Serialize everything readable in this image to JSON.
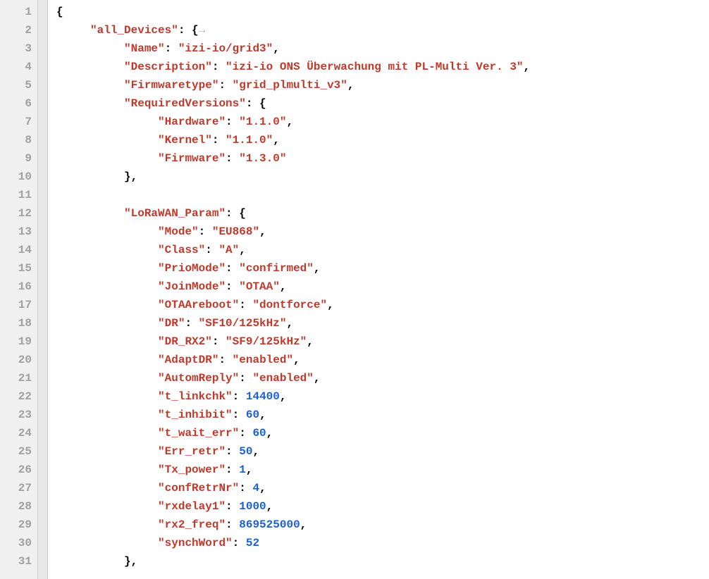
{
  "file": {
    "lines": [
      {
        "num": 1,
        "indent": 0,
        "tokens": [
          {
            "t": "p",
            "v": "{"
          }
        ]
      },
      {
        "num": 2,
        "indent": 1,
        "tokens": [
          {
            "t": "k",
            "v": "\"all_Devices\""
          },
          {
            "t": "p",
            "v": ": {"
          },
          {
            "t": "ws",
            "v": "→"
          }
        ]
      },
      {
        "num": 3,
        "indent": 2,
        "tokens": [
          {
            "t": "k",
            "v": "\"Name\""
          },
          {
            "t": "p",
            "v": ": "
          },
          {
            "t": "s",
            "v": "\"izi-io/grid3\""
          },
          {
            "t": "p",
            "v": ","
          }
        ]
      },
      {
        "num": 4,
        "indent": 2,
        "tokens": [
          {
            "t": "k",
            "v": "\"Description\""
          },
          {
            "t": "p",
            "v": ": "
          },
          {
            "t": "s",
            "v": "\"izi-io ONS Überwachung mit PL-Multi Ver. 3\""
          },
          {
            "t": "p",
            "v": ","
          }
        ]
      },
      {
        "num": 5,
        "indent": 2,
        "tokens": [
          {
            "t": "k",
            "v": "\"Firmwaretype\""
          },
          {
            "t": "p",
            "v": ": "
          },
          {
            "t": "s",
            "v": "\"grid_plmulti_v3\""
          },
          {
            "t": "p",
            "v": ","
          }
        ]
      },
      {
        "num": 6,
        "indent": 2,
        "tokens": [
          {
            "t": "k",
            "v": "\"RequiredVersions\""
          },
          {
            "t": "p",
            "v": ": {"
          }
        ]
      },
      {
        "num": 7,
        "indent": 3,
        "tokens": [
          {
            "t": "k",
            "v": "\"Hardware\""
          },
          {
            "t": "p",
            "v": ": "
          },
          {
            "t": "s",
            "v": "\"1.1.0\""
          },
          {
            "t": "p",
            "v": ","
          }
        ]
      },
      {
        "num": 8,
        "indent": 3,
        "tokens": [
          {
            "t": "k",
            "v": "\"Kernel\""
          },
          {
            "t": "p",
            "v": ": "
          },
          {
            "t": "s",
            "v": "\"1.1.0\""
          },
          {
            "t": "p",
            "v": ","
          }
        ]
      },
      {
        "num": 9,
        "indent": 3,
        "tokens": [
          {
            "t": "k",
            "v": "\"Firmware\""
          },
          {
            "t": "p",
            "v": ": "
          },
          {
            "t": "s",
            "v": "\"1.3.0\""
          }
        ]
      },
      {
        "num": 10,
        "indent": 2,
        "tokens": [
          {
            "t": "p",
            "v": "},"
          }
        ]
      },
      {
        "num": 11,
        "indent": 0,
        "tokens": []
      },
      {
        "num": 12,
        "indent": 2,
        "tokens": [
          {
            "t": "k",
            "v": "\"LoRaWAN_Param\""
          },
          {
            "t": "p",
            "v": ": {"
          }
        ]
      },
      {
        "num": 13,
        "indent": 3,
        "tokens": [
          {
            "t": "k",
            "v": "\"Mode\""
          },
          {
            "t": "p",
            "v": ": "
          },
          {
            "t": "s",
            "v": "\"EU868\""
          },
          {
            "t": "p",
            "v": ","
          }
        ]
      },
      {
        "num": 14,
        "indent": 3,
        "tokens": [
          {
            "t": "k",
            "v": "\"Class\""
          },
          {
            "t": "p",
            "v": ": "
          },
          {
            "t": "s",
            "v": "\"A\""
          },
          {
            "t": "p",
            "v": ","
          }
        ]
      },
      {
        "num": 15,
        "indent": 3,
        "tokens": [
          {
            "t": "k",
            "v": "\"PrioMode\""
          },
          {
            "t": "p",
            "v": ": "
          },
          {
            "t": "s",
            "v": "\"confirmed\""
          },
          {
            "t": "p",
            "v": ","
          }
        ]
      },
      {
        "num": 16,
        "indent": 3,
        "tokens": [
          {
            "t": "k",
            "v": "\"JoinMode\""
          },
          {
            "t": "p",
            "v": ": "
          },
          {
            "t": "s",
            "v": "\"OTAA\""
          },
          {
            "t": "p",
            "v": ","
          }
        ]
      },
      {
        "num": 17,
        "indent": 3,
        "tokens": [
          {
            "t": "k",
            "v": "\"OTAAreboot\""
          },
          {
            "t": "p",
            "v": ": "
          },
          {
            "t": "s",
            "v": "\"dontforce\""
          },
          {
            "t": "p",
            "v": ","
          }
        ]
      },
      {
        "num": 18,
        "indent": 3,
        "tokens": [
          {
            "t": "k",
            "v": "\"DR\""
          },
          {
            "t": "p",
            "v": ": "
          },
          {
            "t": "s",
            "v": "\"SF10/125kHz\""
          },
          {
            "t": "p",
            "v": ","
          }
        ]
      },
      {
        "num": 19,
        "indent": 3,
        "tokens": [
          {
            "t": "k",
            "v": "\"DR_RX2\""
          },
          {
            "t": "p",
            "v": ": "
          },
          {
            "t": "s",
            "v": "\"SF9/125kHz\""
          },
          {
            "t": "p",
            "v": ","
          }
        ]
      },
      {
        "num": 20,
        "indent": 3,
        "tokens": [
          {
            "t": "k",
            "v": "\"AdaptDR\""
          },
          {
            "t": "p",
            "v": ": "
          },
          {
            "t": "s",
            "v": "\"enabled\""
          },
          {
            "t": "p",
            "v": ","
          }
        ]
      },
      {
        "num": 21,
        "indent": 3,
        "tokens": [
          {
            "t": "k",
            "v": "\"AutomReply\""
          },
          {
            "t": "p",
            "v": ": "
          },
          {
            "t": "s",
            "v": "\"enabled\""
          },
          {
            "t": "p",
            "v": ","
          }
        ]
      },
      {
        "num": 22,
        "indent": 3,
        "tokens": [
          {
            "t": "k",
            "v": "\"t_linkchk\""
          },
          {
            "t": "p",
            "v": ": "
          },
          {
            "t": "n",
            "v": "14400"
          },
          {
            "t": "p",
            "v": ","
          }
        ]
      },
      {
        "num": 23,
        "indent": 3,
        "tokens": [
          {
            "t": "k",
            "v": "\"t_inhibit\""
          },
          {
            "t": "p",
            "v": ": "
          },
          {
            "t": "n",
            "v": "60"
          },
          {
            "t": "p",
            "v": ","
          }
        ]
      },
      {
        "num": 24,
        "indent": 3,
        "tokens": [
          {
            "t": "k",
            "v": "\"t_wait_err\""
          },
          {
            "t": "p",
            "v": ": "
          },
          {
            "t": "n",
            "v": "60"
          },
          {
            "t": "p",
            "v": ","
          }
        ]
      },
      {
        "num": 25,
        "indent": 3,
        "tokens": [
          {
            "t": "k",
            "v": "\"Err_retr\""
          },
          {
            "t": "p",
            "v": ": "
          },
          {
            "t": "n",
            "v": "50"
          },
          {
            "t": "p",
            "v": ","
          }
        ]
      },
      {
        "num": 26,
        "indent": 3,
        "tokens": [
          {
            "t": "k",
            "v": "\"Tx_power\""
          },
          {
            "t": "p",
            "v": ": "
          },
          {
            "t": "n",
            "v": "1"
          },
          {
            "t": "p",
            "v": ","
          }
        ]
      },
      {
        "num": 27,
        "indent": 3,
        "tokens": [
          {
            "t": "k",
            "v": "\"confRetrNr\""
          },
          {
            "t": "p",
            "v": ": "
          },
          {
            "t": "n",
            "v": "4"
          },
          {
            "t": "p",
            "v": ","
          }
        ]
      },
      {
        "num": 28,
        "indent": 3,
        "tokens": [
          {
            "t": "k",
            "v": "\"rxdelay1\""
          },
          {
            "t": "p",
            "v": ": "
          },
          {
            "t": "n",
            "v": "1000"
          },
          {
            "t": "p",
            "v": ","
          }
        ]
      },
      {
        "num": 29,
        "indent": 3,
        "tokens": [
          {
            "t": "k",
            "v": "\"rx2_freq\""
          },
          {
            "t": "p",
            "v": ": "
          },
          {
            "t": "n",
            "v": "869525000"
          },
          {
            "t": "p",
            "v": ","
          }
        ]
      },
      {
        "num": 30,
        "indent": 3,
        "tokens": [
          {
            "t": "k",
            "v": "\"synchWord\""
          },
          {
            "t": "p",
            "v": ": "
          },
          {
            "t": "n",
            "v": "52"
          }
        ]
      },
      {
        "num": 31,
        "indent": 2,
        "tokens": [
          {
            "t": "p",
            "v": "},"
          }
        ]
      }
    ],
    "indent_unit": "     "
  }
}
